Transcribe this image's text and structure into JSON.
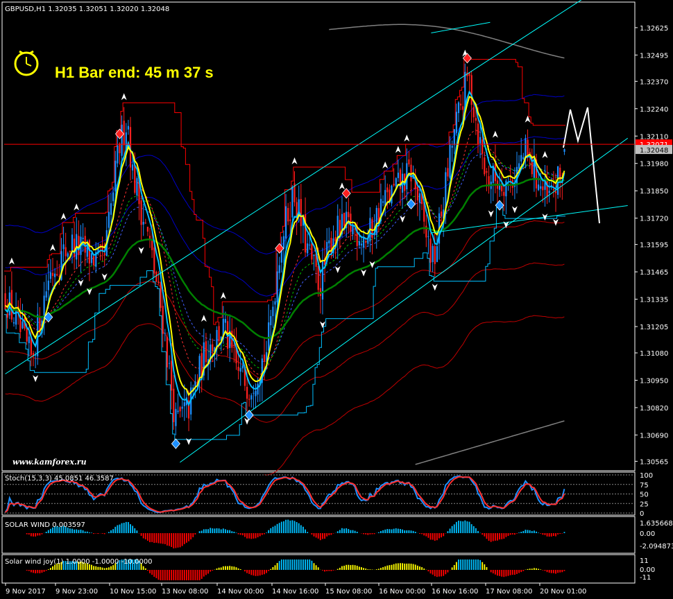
{
  "colors": {
    "background": "#000000",
    "frame": "#ffffff",
    "bull_candle": "#1e90ff",
    "bear_candle": "#ff2020",
    "price_line": "#ff0000",
    "price_label_bg": "#c0c0c0",
    "fast_ma": "#ffff00",
    "cyan_ma": "#00bfff",
    "slow_ma": "#008000",
    "channel_upper": "#ff0000",
    "channel_lower": "#00bfff",
    "envelope_blue": "#0000c8",
    "envelope_red": "#c00000",
    "trendline": "#00ffff",
    "grey_band": "#808080",
    "solar_pos": "#00bfff",
    "solar_neg": "#ff0000",
    "stoch_main": "#1e90ff",
    "stoch_signal": "#ff3030"
  },
  "header": {
    "symbol_text": "GBPUSD,H1  1.32035 1.32051 1.32020 1.32048",
    "bar_end_text": "H1 Bar end: 45 m 37 s",
    "watermark": "www.kamforex.ru",
    "icon": "clock-icon"
  },
  "chart_data": [
    {
      "type": "candlestick",
      "title": "GBPUSD,H1",
      "ohlc_last": {
        "open": 1.32035,
        "high": 1.32051,
        "low": 1.3202,
        "close": 1.32048
      },
      "current_price": 1.32048,
      "current_price_label": "1.32048",
      "marked_level": 1.32071,
      "marked_level_label": "1.32071",
      "ylim": [
        1.3053,
        1.3273
      ],
      "y_ticks": [
        "1.32625",
        "1.32495",
        "1.32370",
        "1.32240",
        "1.32110",
        "1.31980",
        "1.31850",
        "1.31720",
        "1.31595",
        "1.31465",
        "1.31335",
        "1.31205",
        "1.31080",
        "1.30950",
        "1.30820",
        "1.30690",
        "1.30565"
      ],
      "x_ticks": [
        "9 Nov 2017",
        "9 Nov 23:00",
        "10 Nov 15:00",
        "13 Nov 08:00",
        "14 Nov 00:00",
        "14 Nov 16:00",
        "15 Nov 08:00",
        "16 Nov 00:00",
        "16 Nov 16:00",
        "17 Nov 08:00",
        "20 Nov 01:00"
      ],
      "price_path": [
        [
          0,
          1.3135
        ],
        [
          12,
          1.3105
        ],
        [
          20,
          1.3145
        ],
        [
          30,
          1.316
        ],
        [
          45,
          1.315
        ],
        [
          52,
          1.3205
        ],
        [
          56,
          1.322
        ],
        [
          58,
          1.3195
        ],
        [
          66,
          1.316
        ],
        [
          72,
          1.3125
        ],
        [
          78,
          1.3075
        ],
        [
          84,
          1.3082
        ],
        [
          92,
          1.311
        ],
        [
          100,
          1.312
        ],
        [
          106,
          1.31
        ],
        [
          112,
          1.3092
        ],
        [
          120,
          1.311
        ],
        [
          126,
          1.316
        ],
        [
          132,
          1.3185
        ],
        [
          138,
          1.3158
        ],
        [
          144,
          1.314
        ],
        [
          150,
          1.3165
        ],
        [
          158,
          1.3168
        ],
        [
          166,
          1.3162
        ],
        [
          172,
          1.3178
        ],
        [
          180,
          1.3187
        ],
        [
          186,
          1.3194
        ],
        [
          196,
          1.315
        ],
        [
          205,
          1.321
        ],
        [
          212,
          1.324
        ],
        [
          220,
          1.3192
        ],
        [
          226,
          1.319
        ],
        [
          232,
          1.319
        ],
        [
          238,
          1.3203
        ],
        [
          242,
          1.3195
        ],
        [
          248,
          1.318
        ],
        [
          256,
          1.3194
        ]
      ],
      "indicators": [
        "yellow fast MA",
        "cyan MA",
        "green slow MA",
        "red/green dashed MAs",
        "red upper price channel",
        "cyan lower price channel",
        "blue and red envelopes",
        "grey outer band",
        "cyan trend channel"
      ],
      "fractal_markers": "white arrows above highs and below lows; red and cyan diamonds at channel extremes"
    },
    {
      "type": "line",
      "title": "Stoch(15,3,3) 45.0851 46.3587",
      "ylim": [
        0,
        100
      ],
      "levels": [
        "100",
        "75",
        "50",
        "25",
        "0"
      ],
      "series": [
        {
          "name": "main"
        },
        {
          "name": "signal"
        }
      ]
    },
    {
      "type": "bar",
      "title": "SOLAR WIND 0.003597",
      "y_ticks": [
        "1.635668",
        "0.00",
        "-2.094873"
      ]
    },
    {
      "type": "bar",
      "title": "Solar wind joy(1) 1.0000 -1.0000 -10.0000",
      "y_ticks": [
        "11",
        "0.00",
        "-11"
      ]
    }
  ]
}
